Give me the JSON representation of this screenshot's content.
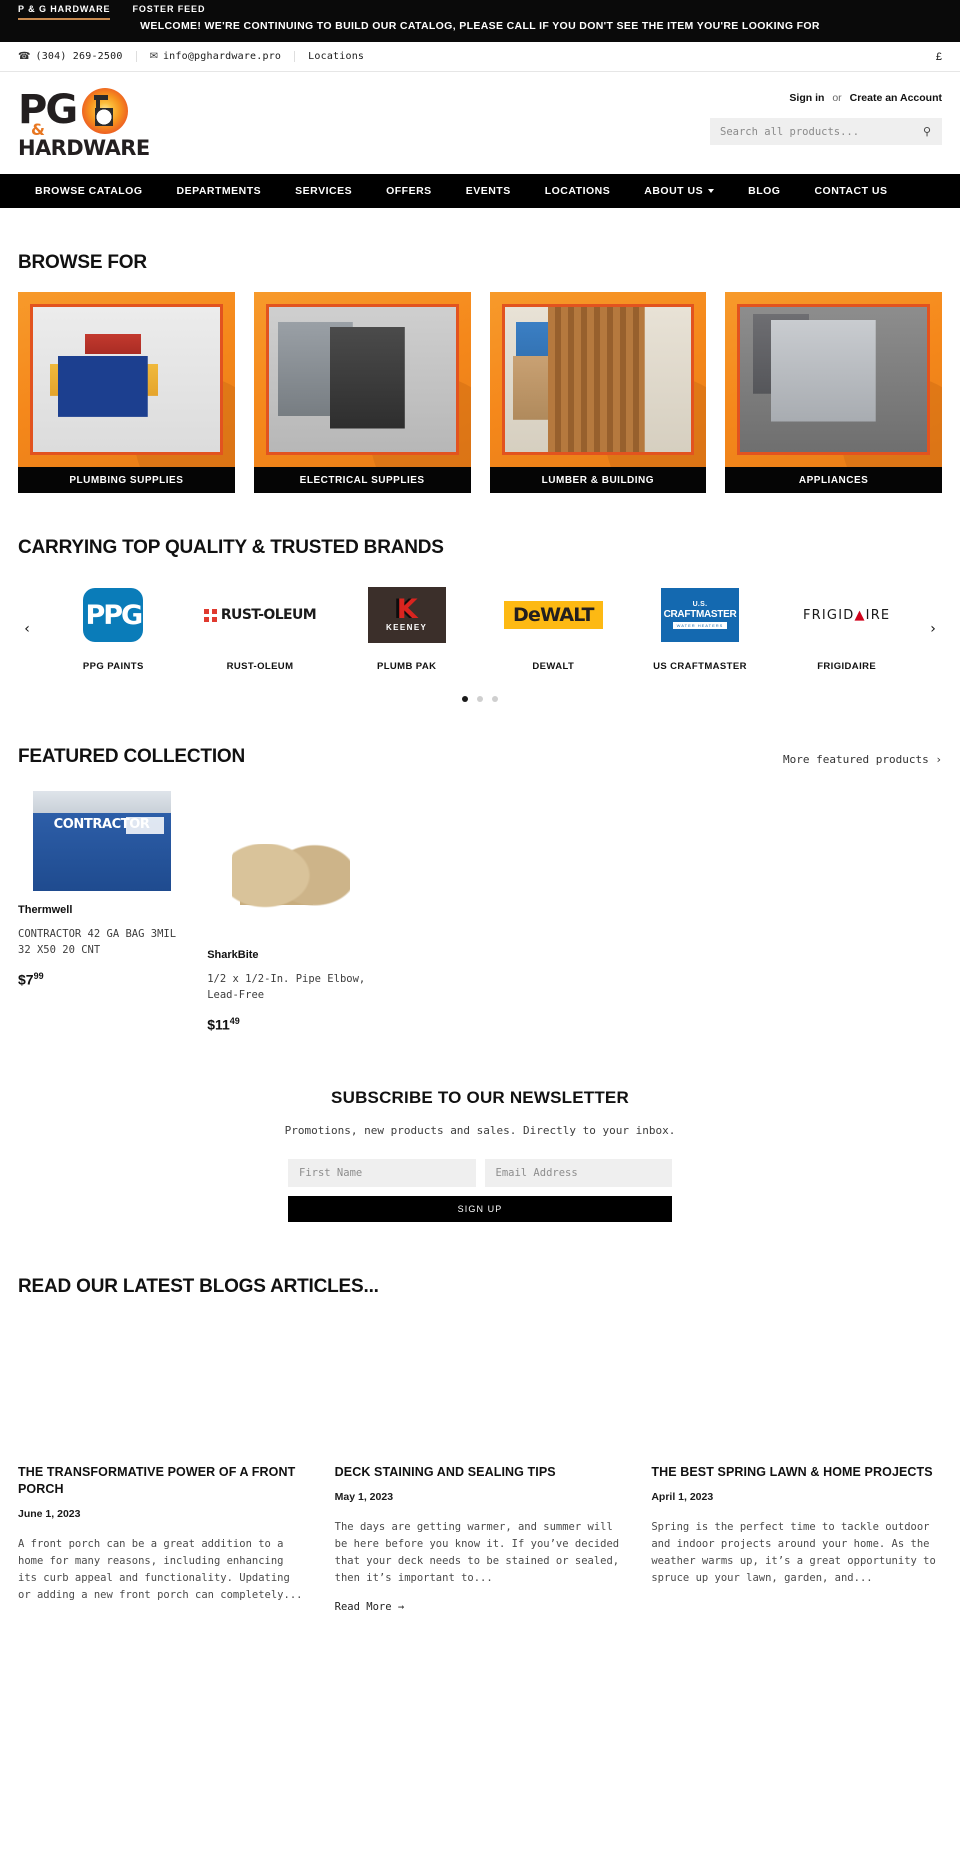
{
  "topbar": {
    "tabs": [
      {
        "label": "P & G HARDWARE",
        "active": true
      },
      {
        "label": "FOSTER FEED",
        "active": false
      }
    ],
    "message": "WELCOME! WE'RE CONTINUING TO BUILD OUR CATALOG, PLEASE CALL IF YOU DON'T SEE THE ITEM YOU'RE LOOKING FOR"
  },
  "utilbar": {
    "phone": "(304) 269-2500",
    "phone_icon": "phone-icon",
    "email": "info@pghardware.pro",
    "email_icon": "envelope-icon",
    "locations": "Locations",
    "currency": "£"
  },
  "header": {
    "logo": {
      "primary": "PG",
      "amp": "&",
      "secondary": "HARDWARE",
      "badge_icon": "hammer-fist-icon"
    },
    "account": {
      "sign_in": "Sign in",
      "separator": "or",
      "create": "Create an Account"
    },
    "search": {
      "placeholder": "Search all products...",
      "value": "",
      "button_icon": "search-icon",
      "button_glyph": "⚲"
    }
  },
  "nav": {
    "items": [
      {
        "label": "BROWSE CATALOG",
        "caret": false
      },
      {
        "label": "DEPARTMENTS",
        "caret": false
      },
      {
        "label": "SERVICES",
        "caret": false
      },
      {
        "label": "OFFERS",
        "caret": false
      },
      {
        "label": "EVENTS",
        "caret": false
      },
      {
        "label": "LOCATIONS",
        "caret": false
      },
      {
        "label": "ABOUT US",
        "caret": true
      },
      {
        "label": "BLOG",
        "caret": false
      },
      {
        "label": "CONTACT US",
        "caret": false
      }
    ]
  },
  "browse": {
    "heading": "BROWSE FOR",
    "tiles": [
      {
        "label": "PLUMBING SUPPLIES",
        "photo_class": "ph-plumb",
        "photo_name": "plumbing-tool-belt-photo"
      },
      {
        "label": "ELECTRICAL SUPPLIES",
        "photo_class": "ph-elec",
        "photo_name": "electrical-panel-photo"
      },
      {
        "label": "LUMBER & BUILDING",
        "photo_class": "ph-lumber",
        "photo_name": "lumber-stack-photo"
      },
      {
        "label": "APPLIANCES",
        "photo_class": "ph-appl",
        "photo_name": "appliance-oven-photo"
      }
    ]
  },
  "brands": {
    "heading": "CARRYING TOP QUALITY & TRUSTED BRANDS",
    "prev_icon": "chevron-left-icon",
    "next_icon": "chevron-right-icon",
    "prev_glyph": "‹",
    "next_glyph": "›",
    "items": [
      {
        "name": "PPG PAINTS",
        "logo_text": "PPG"
      },
      {
        "name": "RUST-OLEUM",
        "logo_text": "RUST-OLEUM"
      },
      {
        "name": "PLUMB PAK",
        "logo_text": "K",
        "logo_sub": "KEENEY"
      },
      {
        "name": "DEWALT",
        "logo_text": "DeWALT"
      },
      {
        "name": "US CRAFTMASTER",
        "logo_text": "CRAFTMASTER",
        "logo_top": "U.S.",
        "logo_sub": "WATER HEATERS"
      },
      {
        "name": "FRIGIDAIRE",
        "logo_text": "FRIGID",
        "logo_tri": "▲",
        "logo_tail": "IRE"
      }
    ],
    "dots": [
      {
        "active": true
      },
      {
        "active": false
      },
      {
        "active": false
      }
    ]
  },
  "featured": {
    "heading": "FEATURED COLLECTION",
    "more_label": "More featured products ›",
    "products": [
      {
        "vendor": "Thermwell",
        "title": "CONTRACTOR 42 GA BAG 3MIL 32 X50 20 CNT",
        "price_main": "$7",
        "price_cents": "99",
        "img_class": "pi-bags",
        "img_name": "contractor-bags-box-image",
        "img_text": "CONTRACTOR"
      },
      {
        "vendor": "SharkBite",
        "title": "1/2 x 1/2-In. Pipe Elbow, Lead-Free",
        "price_main": "$11",
        "price_cents": "49",
        "img_class": "pi-elbow",
        "img_name": "brass-pipe-elbow-image",
        "img_text": ""
      }
    ]
  },
  "newsletter": {
    "heading": "SUBSCRIBE TO OUR NEWSLETTER",
    "subtext": "Promotions, new products and sales. Directly to your inbox.",
    "first_name_placeholder": "First Name",
    "first_name_value": "",
    "email_placeholder": "Email Address",
    "email_value": "",
    "button_label": "SIGN UP"
  },
  "blog": {
    "heading": "READ OUR LATEST BLOGS ARTICLES...",
    "posts": [
      {
        "title": "THE TRANSFORMATIVE POWER OF A FRONT PORCH",
        "date": "June 1, 2023",
        "excerpt": "A front porch can be a great addition to a home for many reasons, including enhancing its curb appeal and functionality. Updating or adding a new front porch can completely...",
        "read_more": ""
      },
      {
        "title": "DECK STAINING AND SEALING TIPS",
        "date": "May 1, 2023",
        "excerpt": "The days are getting warmer, and summer will be here before you know it. If you’ve decided that your deck needs to be stained or sealed, then it’s important to...",
        "read_more": "Read More →"
      },
      {
        "title": "THE BEST SPRING LAWN & HOME PROJECTS",
        "date": "April 1, 2023",
        "excerpt": "Spring is the perfect time to tackle outdoor and indoor projects around your home. As the weather warms up, it’s a great opportunity to spruce up your lawn, garden, and...",
        "read_more": ""
      }
    ]
  }
}
